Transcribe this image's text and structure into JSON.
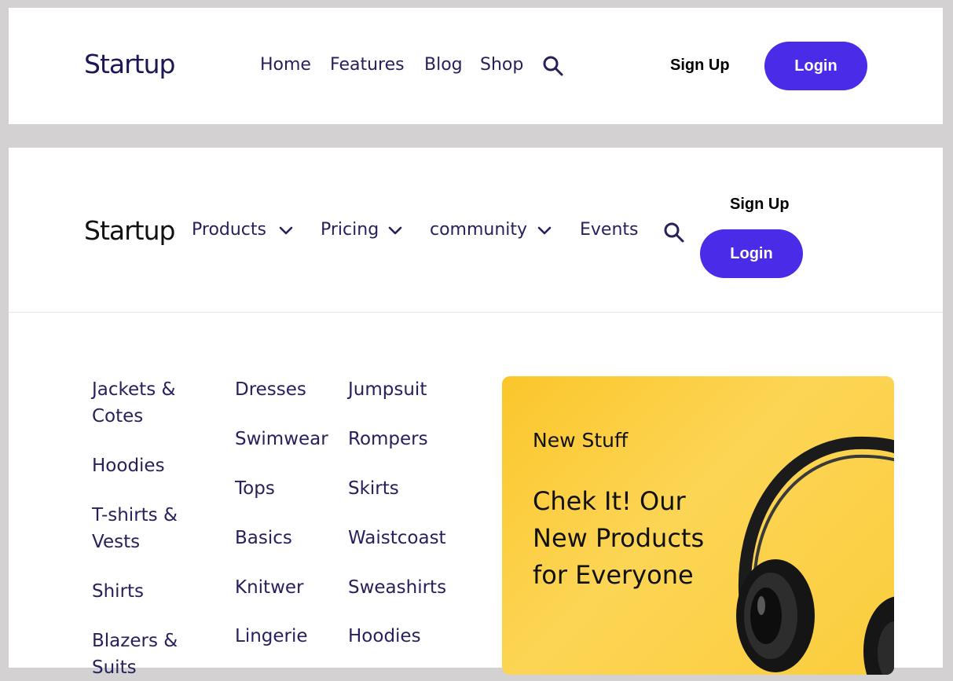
{
  "header1": {
    "logo": "Startup",
    "nav": [
      "Home",
      "Features",
      "Blog",
      "Shop"
    ],
    "signup": "Sign Up",
    "login": "Login"
  },
  "header2": {
    "logo": "Startup",
    "nav": [
      "Products",
      "Pricing",
      "community",
      "Events"
    ],
    "signup": "Sign Up",
    "login": "Login"
  },
  "megamenu": {
    "col1": [
      "Jackets & Cotes",
      "Hoodies",
      "T-shirts & Vests",
      "Shirts",
      "Blazers & Suits"
    ],
    "col2": [
      "Dresses",
      "Swimwear",
      "Tops",
      "Basics",
      "Knitwer",
      "Lingerie"
    ],
    "col3": [
      "Jumpsuit",
      "Rompers",
      "Skirts",
      "Waistcoast",
      "Sweashirts",
      "Hoodies"
    ],
    "promo": {
      "eyebrow": "New Stuff",
      "title": "Chek It! Our New Products for Everyone",
      "image_icon": "headphones-icon"
    }
  },
  "colors": {
    "accent": "#4a2be8",
    "nav_text": "#26215c",
    "page_bg": "#d3d1d2",
    "promo_bg": "#fcd555"
  },
  "icons": {
    "search": "search-icon",
    "chevron": "chevron-down-icon"
  }
}
